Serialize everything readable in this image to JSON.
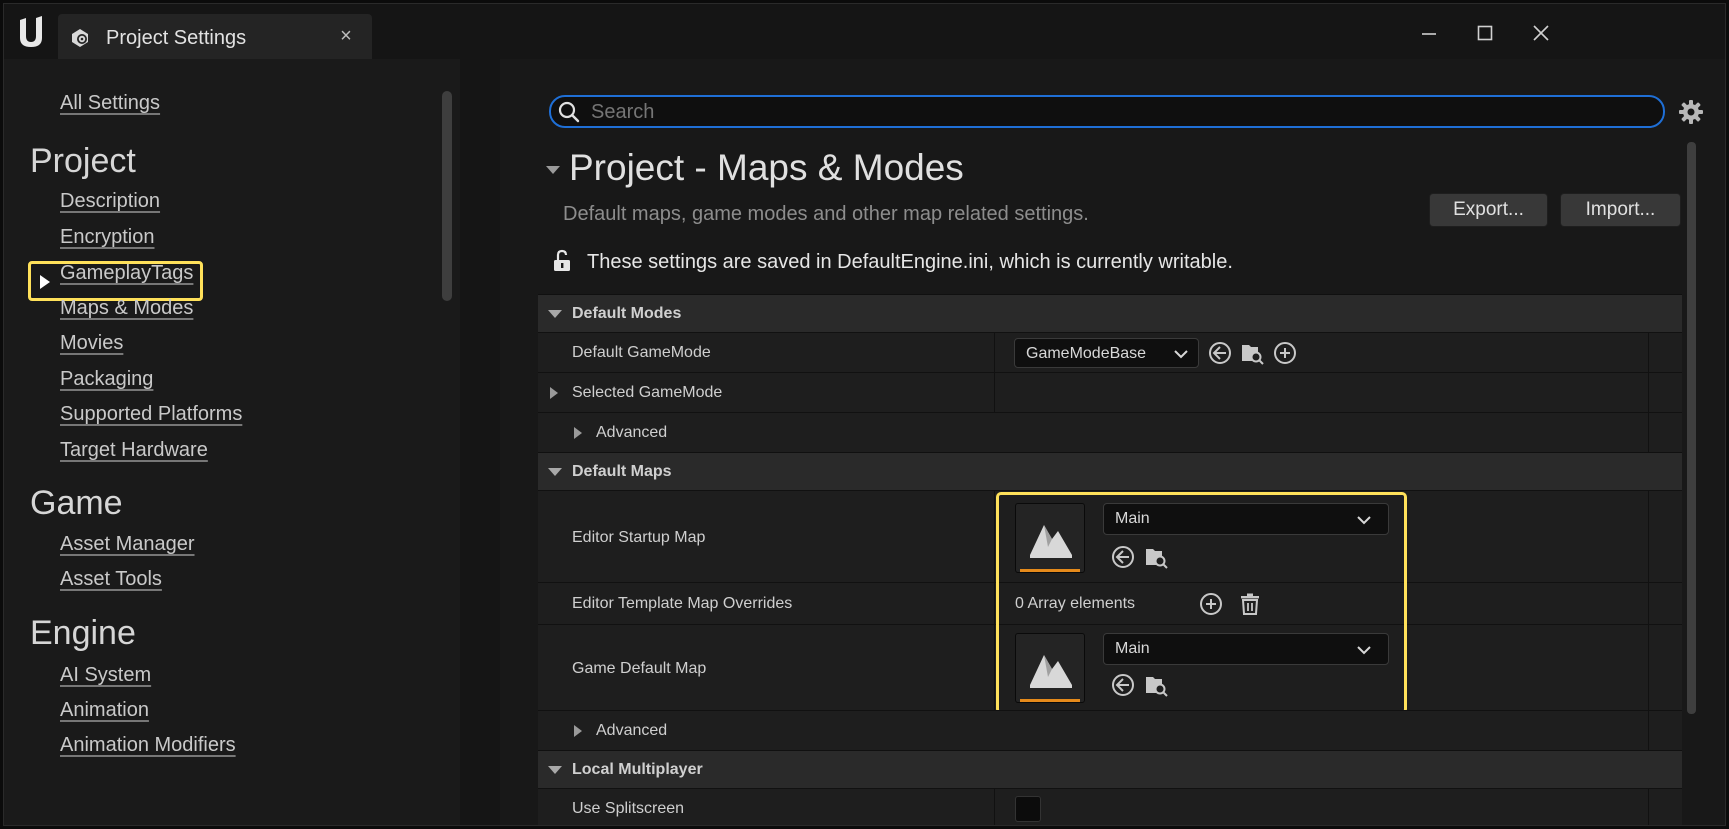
{
  "window": {
    "tab_title": "Project Settings",
    "tab_close": "×"
  },
  "sidebar": {
    "all_settings": "All Settings",
    "categories": [
      {
        "title": "Project",
        "items": [
          "Description",
          "Encryption",
          "GameplayTags",
          "Maps & Modes",
          "Movies",
          "Packaging",
          "Supported Platforms",
          "Target Hardware"
        ]
      },
      {
        "title": "Game",
        "items": [
          "Asset Manager",
          "Asset Tools"
        ]
      },
      {
        "title": "Engine",
        "items": [
          "AI System",
          "Animation",
          "Animation Modifiers"
        ]
      }
    ],
    "selected": "Maps & Modes"
  },
  "search": {
    "placeholder": "Search"
  },
  "page": {
    "title": "Project - Maps & Modes",
    "description": "Default maps, game modes and other map related settings.",
    "export_label": "Export...",
    "import_label": "Import...",
    "notice": "These settings are saved in DefaultEngine.ini, which is currently writable."
  },
  "sections": {
    "default_modes": {
      "label": "Default Modes",
      "default_gamemode_label": "Default GameMode",
      "default_gamemode_value": "GameModeBase",
      "selected_gamemode_label": "Selected GameMode",
      "advanced_label": "Advanced"
    },
    "default_maps": {
      "label": "Default Maps",
      "editor_startup_map_label": "Editor Startup Map",
      "editor_startup_map_value": "Main",
      "template_overrides_label": "Editor Template Map Overrides",
      "template_overrides_value": "0 Array elements",
      "game_default_map_label": "Game Default Map",
      "game_default_map_value": "Main",
      "advanced_label": "Advanced"
    },
    "local_multiplayer": {
      "label": "Local Multiplayer",
      "use_splitscreen_label": "Use Splitscreen",
      "use_splitscreen_value": false
    }
  },
  "colors": {
    "highlight": "#ffe15a",
    "search_border": "#1f6fd6",
    "asset_bar": "#e58a1b"
  }
}
